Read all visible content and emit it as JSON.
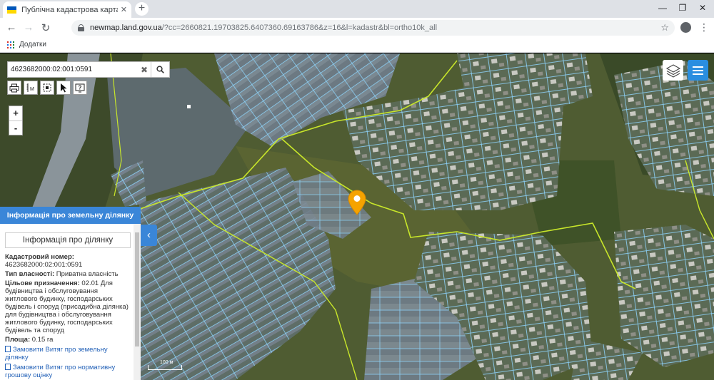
{
  "browser": {
    "tab_title": "Публічна кадастрова карта Укр",
    "url_host": "newmap.land.gov.ua",
    "url_rest": "/?cc=2660821.19703825.6407360.69163786&z=16&l=kadastr&bl=ortho10k_all",
    "bookmarks_label": "Додатки",
    "icons": [
      "ukraine-flag-icon",
      "close-icon",
      "plus-icon",
      "back-icon",
      "forward-icon",
      "reload-icon",
      "lock-icon",
      "star-icon",
      "account-icon",
      "more-icon",
      "apps-icon"
    ]
  },
  "map": {
    "search_value": "4623682000:02:001:0591",
    "zoom_in": "+",
    "zoom_out": "-",
    "tool_icons": [
      "print-icon",
      "measure-icon",
      "select-area-icon",
      "pointer-icon",
      "help-icon"
    ],
    "scale_label": "100 м",
    "colors": {
      "parcel_outline": "#8fd6ff",
      "boundary_line": "#c8e62a",
      "marker": "#f5a300",
      "accent": "#3a86d8"
    }
  },
  "info_panel": {
    "header": "Інформація про земельну ділянку",
    "subheader": "Інформація про ділянку",
    "cadastral_label": "Кадастровий номер:",
    "cadastral_value": "4623682000:02:001:0591",
    "ownership_label": "Тип власності:",
    "ownership_value": "Приватна власність",
    "purpose_label": "Цільове призначення:",
    "purpose_value": "02.01 Для будівництва і обслуговування житлового будинку, господарських будівель і споруд (присадибна ділянка) для будівництва і обслуговування житлового будинку, господарських будівель та споруд",
    "area_label": "Площа:",
    "area_value": "0.15 га",
    "link1": "Замовити Витяг про земельну ділянку",
    "link2": "Замовити Витяг про нормативну грошову оцінку"
  }
}
